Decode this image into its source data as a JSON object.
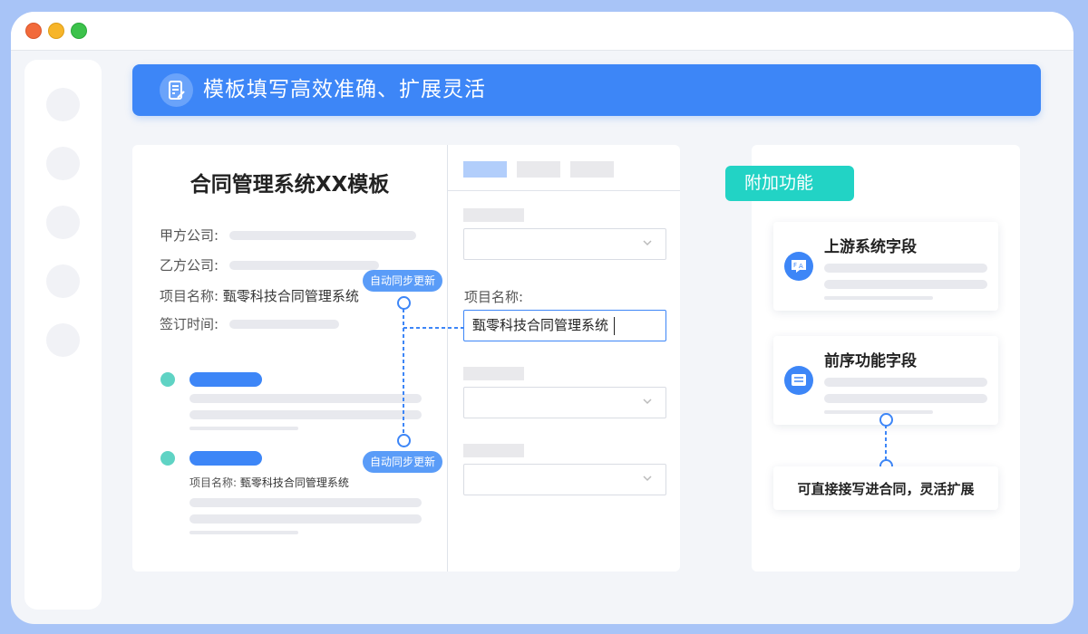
{
  "banner": {
    "title": "模板填写高效准确、扩展灵活",
    "icon": "document-edit-icon"
  },
  "document": {
    "title": "合同管理系统XX模板",
    "fields": [
      {
        "label": "甲方公司:",
        "value": ""
      },
      {
        "label": "乙方公司:",
        "value": ""
      },
      {
        "label": "项目名称:",
        "value": "甄零科技合同管理系统"
      },
      {
        "label": "签订时间:",
        "value": ""
      }
    ],
    "section_item": {
      "label": "项目名称:",
      "value": "甄零科技合同管理系统"
    },
    "sync_badge": "自动同步更新"
  },
  "form": {
    "project_label": "项目名称:",
    "project_value": "甄零科技合同管理系统"
  },
  "addon": {
    "chip": "附加功能",
    "cards": [
      {
        "title": "上游系统字段",
        "icon": "translate-icon"
      },
      {
        "title": "前序功能字段",
        "icon": "message-icon"
      }
    ],
    "note": "可直接接写进合同，灵活扩展"
  },
  "colors": {
    "accent": "#3d86f7",
    "teal": "#22d3c5",
    "background": "#a8c4f7"
  }
}
